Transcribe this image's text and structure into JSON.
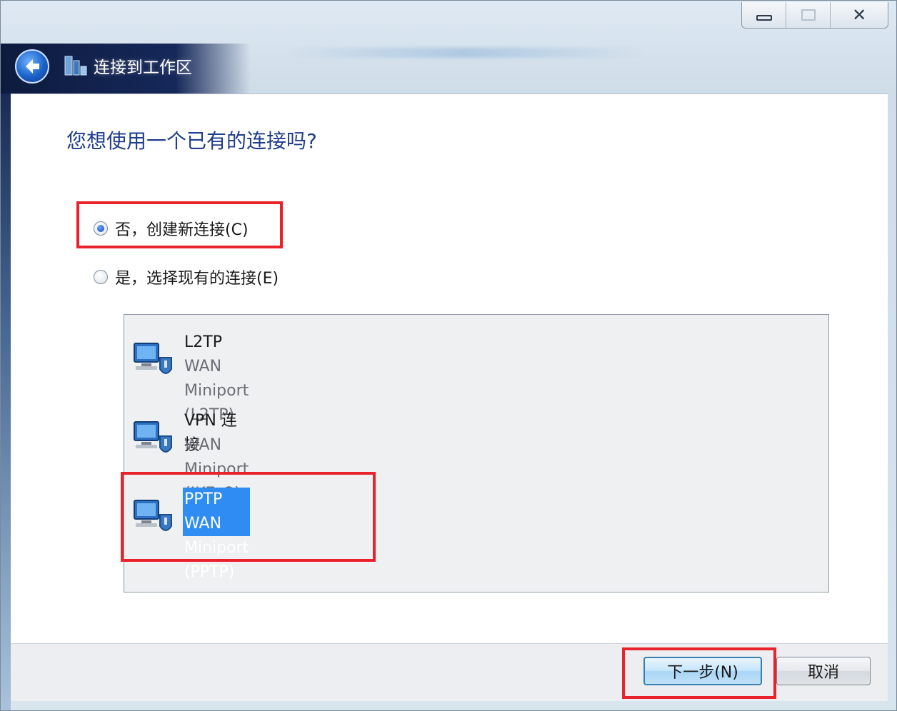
{
  "window": {
    "title": "连接到工作区"
  },
  "page": {
    "heading": "您想使用一个已有的连接吗?"
  },
  "options": [
    {
      "label": "否，创建新连接(C)",
      "selected": true
    },
    {
      "label": "是，选择现有的连接(E)",
      "selected": false
    }
  ],
  "connections": [
    {
      "name": "L2TP",
      "device": "WAN Miniport (L2TP)",
      "selected": false,
      "icon": "network-vpn-icon"
    },
    {
      "name": "VPN 连接",
      "device": "WAN Miniport (IKEv2)",
      "selected": false,
      "icon": "network-vpn-icon"
    },
    {
      "name": "PPTP",
      "device": "WAN Miniport (PPTP)",
      "selected": true,
      "icon": "network-vpn-icon"
    }
  ],
  "buttons": {
    "next": "下一步(N)",
    "cancel": "取消"
  },
  "colors": {
    "heading": "#1e3d8c",
    "highlight": "#e8232b",
    "selection": "#2f8cf2"
  }
}
